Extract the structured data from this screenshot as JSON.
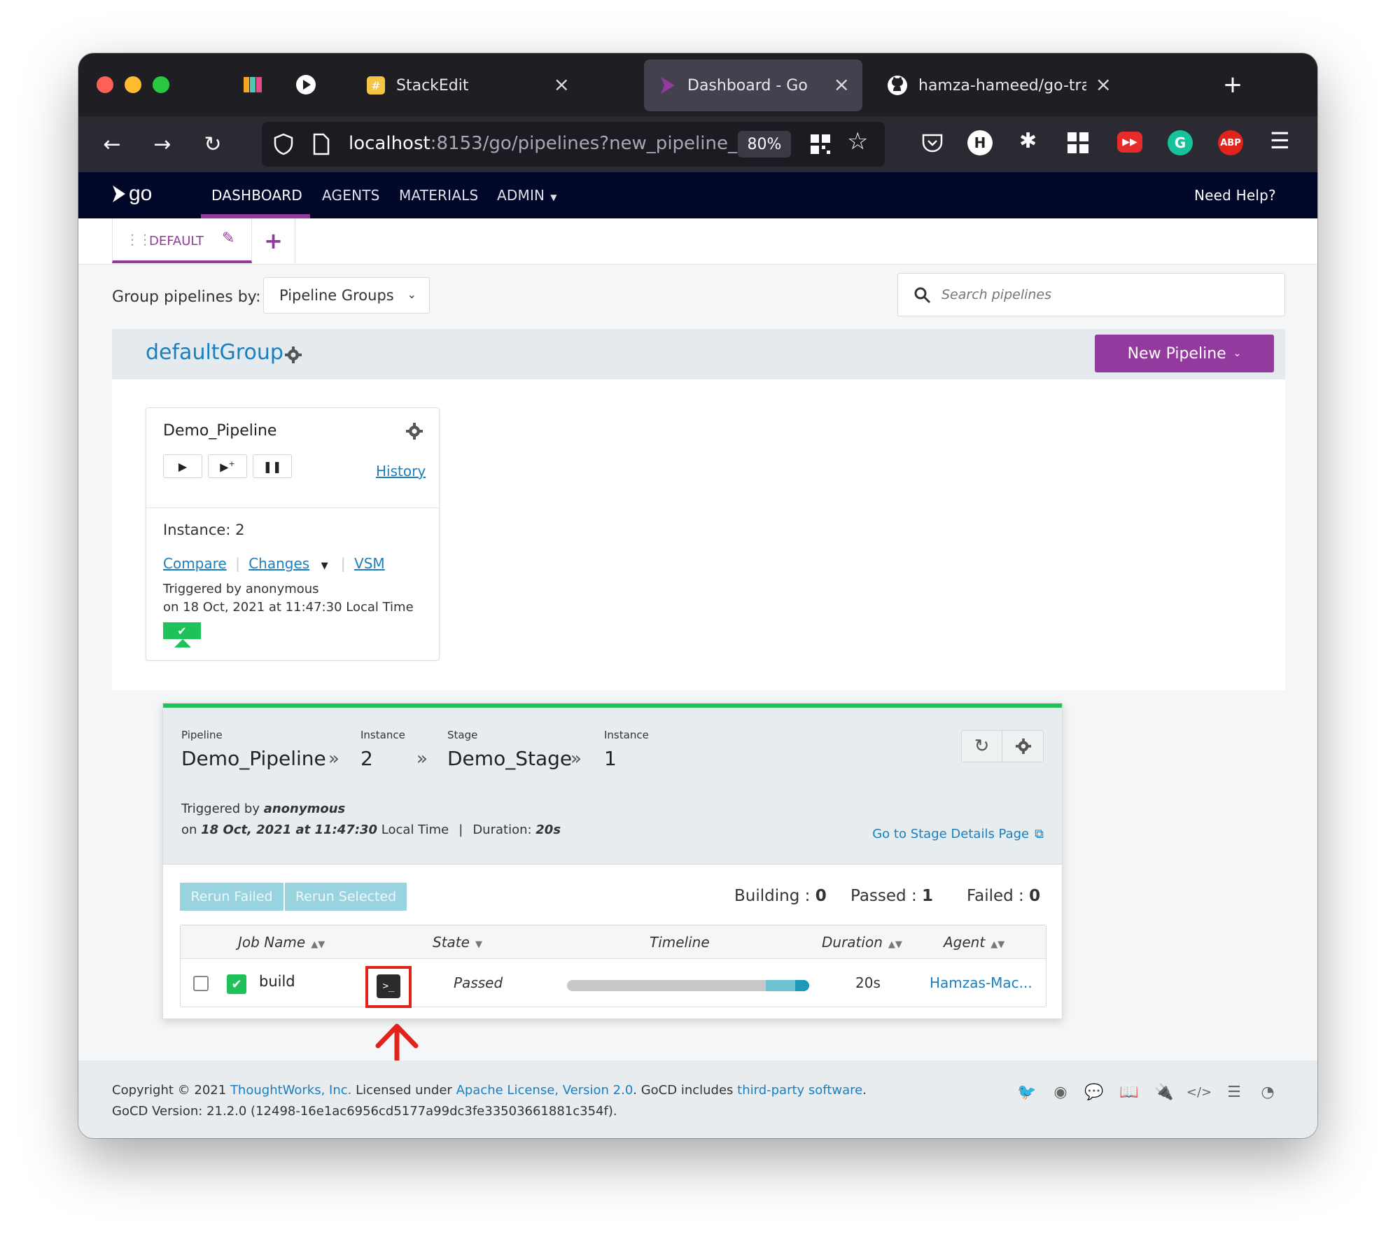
{
  "browser": {
    "tabs": [
      {
        "title": "StackEdit"
      },
      {
        "title": "Dashboard - Go"
      },
      {
        "title": "hamza-hameed/go-training"
      }
    ],
    "url_host": "localhost",
    "url_rest": ":8153/go/pipelines?new_pipeline_",
    "zoom": "80%",
    "ext_labels": {
      "h": "H",
      "abp": "ABP"
    }
  },
  "nav": {
    "items": [
      "DASHBOARD",
      "AGENTS",
      "MATERIALS",
      "ADMIN"
    ],
    "help": "Need Help?"
  },
  "subtabs": {
    "default": "DEFAULT"
  },
  "toolbar": {
    "group_by_label": "Group pipelines by:",
    "group_by_value": "Pipeline Groups",
    "search_placeholder": "Search pipelines"
  },
  "group": {
    "name": "defaultGroup",
    "new_pipeline": "New Pipeline"
  },
  "pipeline_card": {
    "name": "Demo_Pipeline",
    "history": "History",
    "instance": "Instance: 2",
    "compare": "Compare",
    "changes": "Changes",
    "vsm": "VSM",
    "triggered": "Triggered by anonymous",
    "on": "on 18 Oct, 2021 at 11:47:30 Local Time"
  },
  "stage_popup": {
    "labels": {
      "pipeline": "Pipeline",
      "instance": "Instance",
      "stage": "Stage",
      "stage_instance": "Instance"
    },
    "pipeline": "Demo_Pipeline",
    "pipeline_instance": "2",
    "stage": "Demo_Stage",
    "stage_instance": "1",
    "triggered_prefix": "Triggered by ",
    "triggered_by": "anonymous",
    "on_prefix": "on ",
    "date": "18 Oct, 2021 at 11:47:30",
    "local_time": " Local Time",
    "duration_label": "Duration: ",
    "duration": "20s",
    "details_link": "Go to Stage Details Page",
    "rerun_failed": "Rerun Failed",
    "rerun_selected": "Rerun Selected",
    "building_label": "Building : ",
    "building": "0",
    "passed_label": "Passed : ",
    "passed": "1",
    "failed_label": "Failed : ",
    "failed": "0",
    "columns": {
      "job_name": "Job Name",
      "state": "State",
      "timeline": "Timeline",
      "duration": "Duration",
      "agent": "Agent"
    },
    "jobs": [
      {
        "name": "build",
        "state": "Passed",
        "duration": "20s",
        "agent": "Hamzas-Mac...",
        "timeline_progress": 1.0
      }
    ]
  },
  "footer": {
    "copyright": "Copyright © 2021 ",
    "company": "ThoughtWorks, Inc.",
    "licensed": " Licensed under ",
    "license": "Apache License, Version 2.0",
    "includes": ". GoCD includes ",
    "third_party": "third-party software",
    "period": ".",
    "version": "GoCD Version: 21.2.0 (12498-16e1ac6956cd5177a99dc3fe33503661881c354f)."
  },
  "colors": {
    "brand_purple": "#943a9e",
    "nav_bg": "#000728",
    "passed_green": "#1fc25a",
    "link_blue": "#1a7fbf",
    "annotation_red": "#e0231b"
  }
}
